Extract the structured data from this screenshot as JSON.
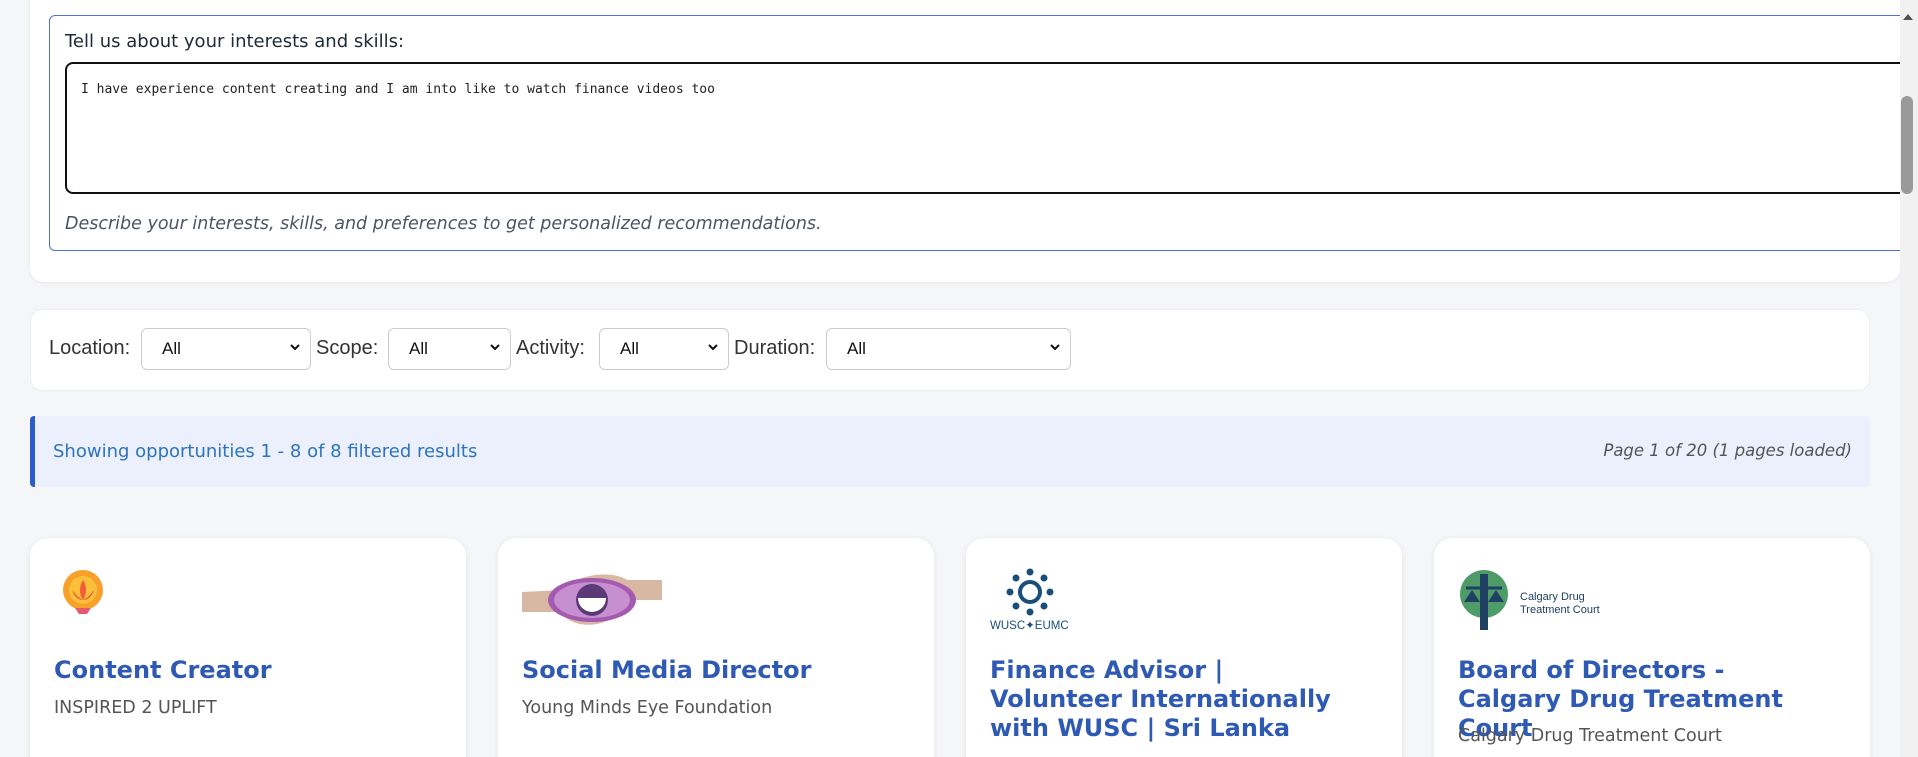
{
  "interests": {
    "label": "Tell us about your interests and skills:",
    "value": "I have experience content creating and I am into like to watch finance videos too",
    "help": "Describe your interests, skills, and preferences to get personalized recommendations."
  },
  "filters": {
    "location_label": "Location:",
    "location_value": "All",
    "scope_label": "Scope:",
    "scope_value": "All",
    "activity_label": "Activity:",
    "activity_value": "All",
    "duration_label": "Duration:",
    "duration_value": "All"
  },
  "results": {
    "summary": "Showing opportunities 1 - 8 of 8 filtered results",
    "page_info": "Page 1 of 20 (1 pages loaded)"
  },
  "cards": [
    {
      "title": "Content Creator",
      "org": "INSPIRED 2 UPLIFT",
      "logo": "lotus-logo-icon"
    },
    {
      "title": "Social Media Director",
      "org": "Young Minds Eye Foundation",
      "logo": "eye-hands-logo-icon"
    },
    {
      "title": "Finance Advisor | Volunteer Internationally with WUSC | Sri Lanka",
      "org": "",
      "logo": "wusc-logo-icon",
      "logo_text": "WUSC✦EUMC"
    },
    {
      "title": "Board of Directors - Calgary Drug Treatment Court",
      "org": "Calgary Drug Treatment Court",
      "logo": "calgary-court-logo-icon",
      "logo_text_1": "Calgary Drug",
      "logo_text_2": "Treatment Court"
    }
  ],
  "colors": {
    "accent": "#2f5ab3",
    "results_bg": "#ebf0fc",
    "results_text": "#2d73bf",
    "border_blue": "#4f6fd6"
  }
}
